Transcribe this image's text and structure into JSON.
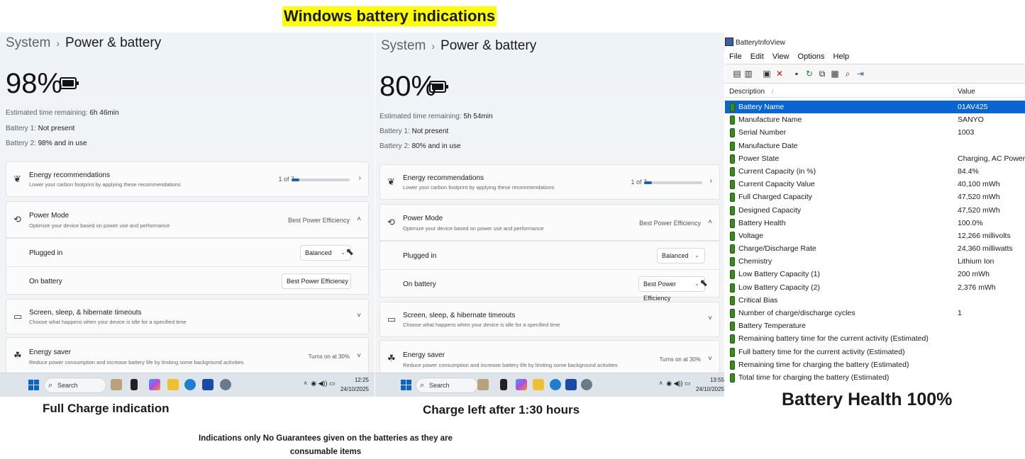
{
  "headline": "Windows battery indications",
  "panels": [
    {
      "breadcrumb_parent": "System",
      "breadcrumb_current": "Power & battery",
      "percent": "98%",
      "est_label": "Estimated time remaining:",
      "est_value": "6h 46min",
      "battery1_label": "Battery 1:",
      "battery1_value": "Not present",
      "battery2_label": "Battery 2:",
      "battery2_value": "98% and in use",
      "energy_rec_title": "Energy recommendations",
      "energy_rec_desc": "Lower your carbon footprint by applying these recommendations",
      "energy_rec_count": "1 of 7",
      "energy_rec_progress": 0.14,
      "power_mode_title": "Power Mode",
      "power_mode_desc": "Optimize your device based on power use and performance",
      "power_mode_value": "Best Power Efficiency",
      "plugged_label": "Plugged in",
      "plugged_value": "Balanced",
      "onbattery_label": "On battery",
      "onbattery_value": "Best Power Efficiency",
      "screen_title": "Screen, sleep, & hibernate timeouts",
      "screen_desc": "Choose what happens when your device is idle for a specified time",
      "saver_title": "Energy saver",
      "saver_desc": "Reduce power consumption and increase battery life by limiting some background activities",
      "saver_value": "Turns on at 30%",
      "search": "Search",
      "time": "12:25",
      "date": "24/10/2025"
    },
    {
      "breadcrumb_parent": "System",
      "breadcrumb_current": "Power & battery",
      "percent": "80%",
      "est_label": "Estimated time remaining:",
      "est_value": "5h 54min",
      "battery1_label": "Battery 1:",
      "battery1_value": "Not present",
      "battery2_label": "Battery 2:",
      "battery2_value": "80% and in use",
      "energy_rec_title": "Energy recommendations",
      "energy_rec_desc": "Lower your carbon footprint by applying these recommendations",
      "energy_rec_count": "1 of 7",
      "energy_rec_progress": 0.14,
      "power_mode_title": "Power Mode",
      "power_mode_desc": "Optimize your device based on power use and performance",
      "power_mode_value": "Best Power Efficiency",
      "plugged_label": "Plugged in",
      "plugged_value": "Balanced",
      "onbattery_label": "On battery",
      "onbattery_value": "Best Power Efficiency",
      "screen_title": "Screen, sleep, & hibernate timeouts",
      "screen_desc": "Choose what happens when your device is idle for a specified time",
      "saver_title": "Energy saver",
      "saver_desc": "Reduce power consumption and increase battery life by limiting some background activities",
      "saver_value": "Turns on at 30%",
      "search": "Search",
      "time": "13:55",
      "date": "24/10/2025"
    }
  ],
  "captions": {
    "full_charge": "Full Charge indication",
    "charge_left": "Charge left after 1:30 hours",
    "battery_health": "Battery Health 100%",
    "note": "Indications only No Guarantees given on the batteries as they are consumable items"
  },
  "battery_info_view": {
    "title": "BatteryInfoView",
    "menu": [
      "File",
      "Edit",
      "View",
      "Options",
      "Help"
    ],
    "col_description": "Description",
    "col_sort": "/",
    "col_value": "Value",
    "rows": [
      {
        "d": "Battery Name",
        "v": "01AV425"
      },
      {
        "d": "Manufacture Name",
        "v": "SANYO"
      },
      {
        "d": "Serial Number",
        "v": "1003"
      },
      {
        "d": "Manufacture Date",
        "v": ""
      },
      {
        "d": "Power State",
        "v": "Charging, AC Power"
      },
      {
        "d": "Current Capacity (in %)",
        "v": "84.4%"
      },
      {
        "d": "Current Capacity Value",
        "v": "40,100 mWh"
      },
      {
        "d": "Full Charged Capacity",
        "v": "47,520 mWh"
      },
      {
        "d": "Designed Capacity",
        "v": "47,520 mWh"
      },
      {
        "d": "Battery Health",
        "v": "100.0%"
      },
      {
        "d": "Voltage",
        "v": "12,266 millivolts"
      },
      {
        "d": "Charge/Discharge Rate",
        "v": "24,360 milliwatts"
      },
      {
        "d": "Chemistry",
        "v": "Lithium Ion"
      },
      {
        "d": "Low Battery Capacity (1)",
        "v": "200 mWh"
      },
      {
        "d": "Low Battery Capacity (2)",
        "v": "2,376 mWh"
      },
      {
        "d": "Critical Bias",
        "v": ""
      },
      {
        "d": "Number of charge/discharge cycles",
        "v": "1"
      },
      {
        "d": "Battery Temperature",
        "v": ""
      },
      {
        "d": "Remaining battery time for the current activity (Estimated)",
        "v": ""
      },
      {
        "d": "Full battery time for the current activity (Estimated)",
        "v": ""
      },
      {
        "d": "Remaining time for charging the battery (Estimated)",
        "v": ""
      },
      {
        "d": "Total  time for charging the battery (Estimated)",
        "v": ""
      }
    ]
  }
}
